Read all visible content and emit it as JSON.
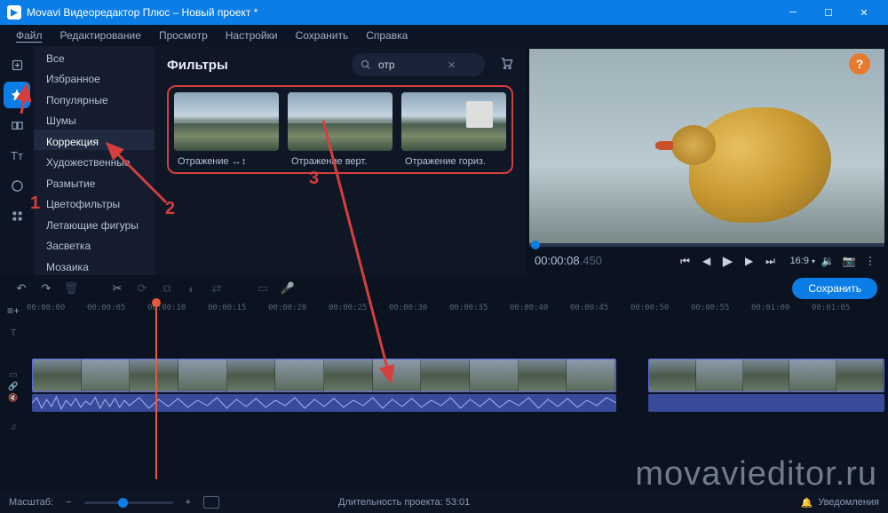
{
  "window": {
    "title": "Movavi Видеоредактор Плюс – Новый проект *",
    "icon_letter": "▶"
  },
  "menu": [
    "Файл",
    "Редактирование",
    "Просмотр",
    "Настройки",
    "Сохранить",
    "Справка"
  ],
  "toolstrip_active_index": 1,
  "categories": [
    "Все",
    "Избранное",
    "Популярные",
    "Шумы",
    "Коррекция",
    "Художественные",
    "Размытие",
    "Цветофильтры",
    "Летающие фигуры",
    "Засветка",
    "Мозаика"
  ],
  "category_selected": "Коррекция",
  "filters_panel": {
    "title": "Фильтры",
    "search_value": "отр",
    "search_placeholder": ""
  },
  "filters": [
    {
      "label": "Отражение ↔↕"
    },
    {
      "label": "Отражение верт."
    },
    {
      "label": "Отражение гориз."
    }
  ],
  "preview": {
    "timecode": "00:00:08",
    "timecode_ms": ".450",
    "aspect": "16:9"
  },
  "help_label": "?",
  "timeline": {
    "save_btn": "Сохранить",
    "ruler": [
      "00:00:00",
      "00:00:05",
      "00:00:10",
      "00:00:15",
      "00:00:20",
      "00:00:25",
      "00:00:30",
      "00:00:35",
      "00:00:40",
      "00:00:45",
      "00:00:50",
      "00:00:55",
      "00:01:00",
      "00:01:05"
    ]
  },
  "status": {
    "zoom_label": "Масштаб:",
    "minus": "−",
    "plus": "+",
    "duration_label": "Длительность проекта:  53:01",
    "notifications": "Уведомления"
  },
  "annotations": {
    "n1": "1",
    "n2": "2",
    "n3": "3"
  },
  "watermark": "movavieditor.ru"
}
